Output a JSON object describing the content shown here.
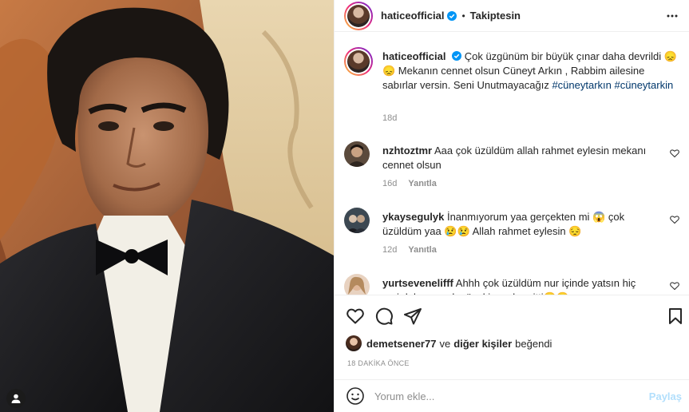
{
  "header": {
    "username": "haticeofficial",
    "separator": "•",
    "follow_status": "Takiptesin"
  },
  "caption": {
    "username": "haticeofficial",
    "text": "Çok üzgünüm bir büyük çınar daha devrildi 😞😞 Mekanın cennet olsun Cüneyt Arkın , Rabbim ailesine sabırlar versin. Seni Unutmayacağız",
    "hashtag1": "#cüneytarkın",
    "hashtag2": "#cüneytarkin",
    "time": "18d"
  },
  "comments": [
    {
      "username": "nzhtoztmr",
      "text": "Aaa çok üzüldüm allah rahmet eylesin mekanı cennet olsun",
      "time": "16d",
      "reply": "Yanıtla"
    },
    {
      "username": "ykaysegulyk",
      "text": "İnanmıyorum yaa gerçekten mi 😱 çok üzüldüm yaa 😢😢 Allah rahmet eylesin 😔",
      "time": "12d",
      "reply": "Yanıtla"
    },
    {
      "username": "yurtsevenelifff",
      "text": "Ahhh çok üzüldüm nur içinde yatsın hiç yeri dolmayacak güzel insanlar gitti😢😢"
    }
  ],
  "likes": {
    "user": "demetsener77",
    "connector": "ve",
    "others": "diğer kişiler",
    "suffix": "beğendi"
  },
  "timestamp": "18 DAKİKA ÖNCE",
  "comment_input": {
    "placeholder": "Yorum ekle...",
    "post_label": "Paylaş"
  },
  "icons": {
    "more": "more-options-icon",
    "like": "heart-icon",
    "comment": "comment-icon",
    "share": "share-icon",
    "save": "bookmark-icon",
    "emoji": "emoji-icon",
    "tag": "user-tag-icon",
    "verified": "verified-badge-icon"
  },
  "colors": {
    "verified": "#0095f6",
    "hashtag": "#00376b",
    "muted": "#8e8e8e",
    "post_disabled": "#b2dffc"
  }
}
